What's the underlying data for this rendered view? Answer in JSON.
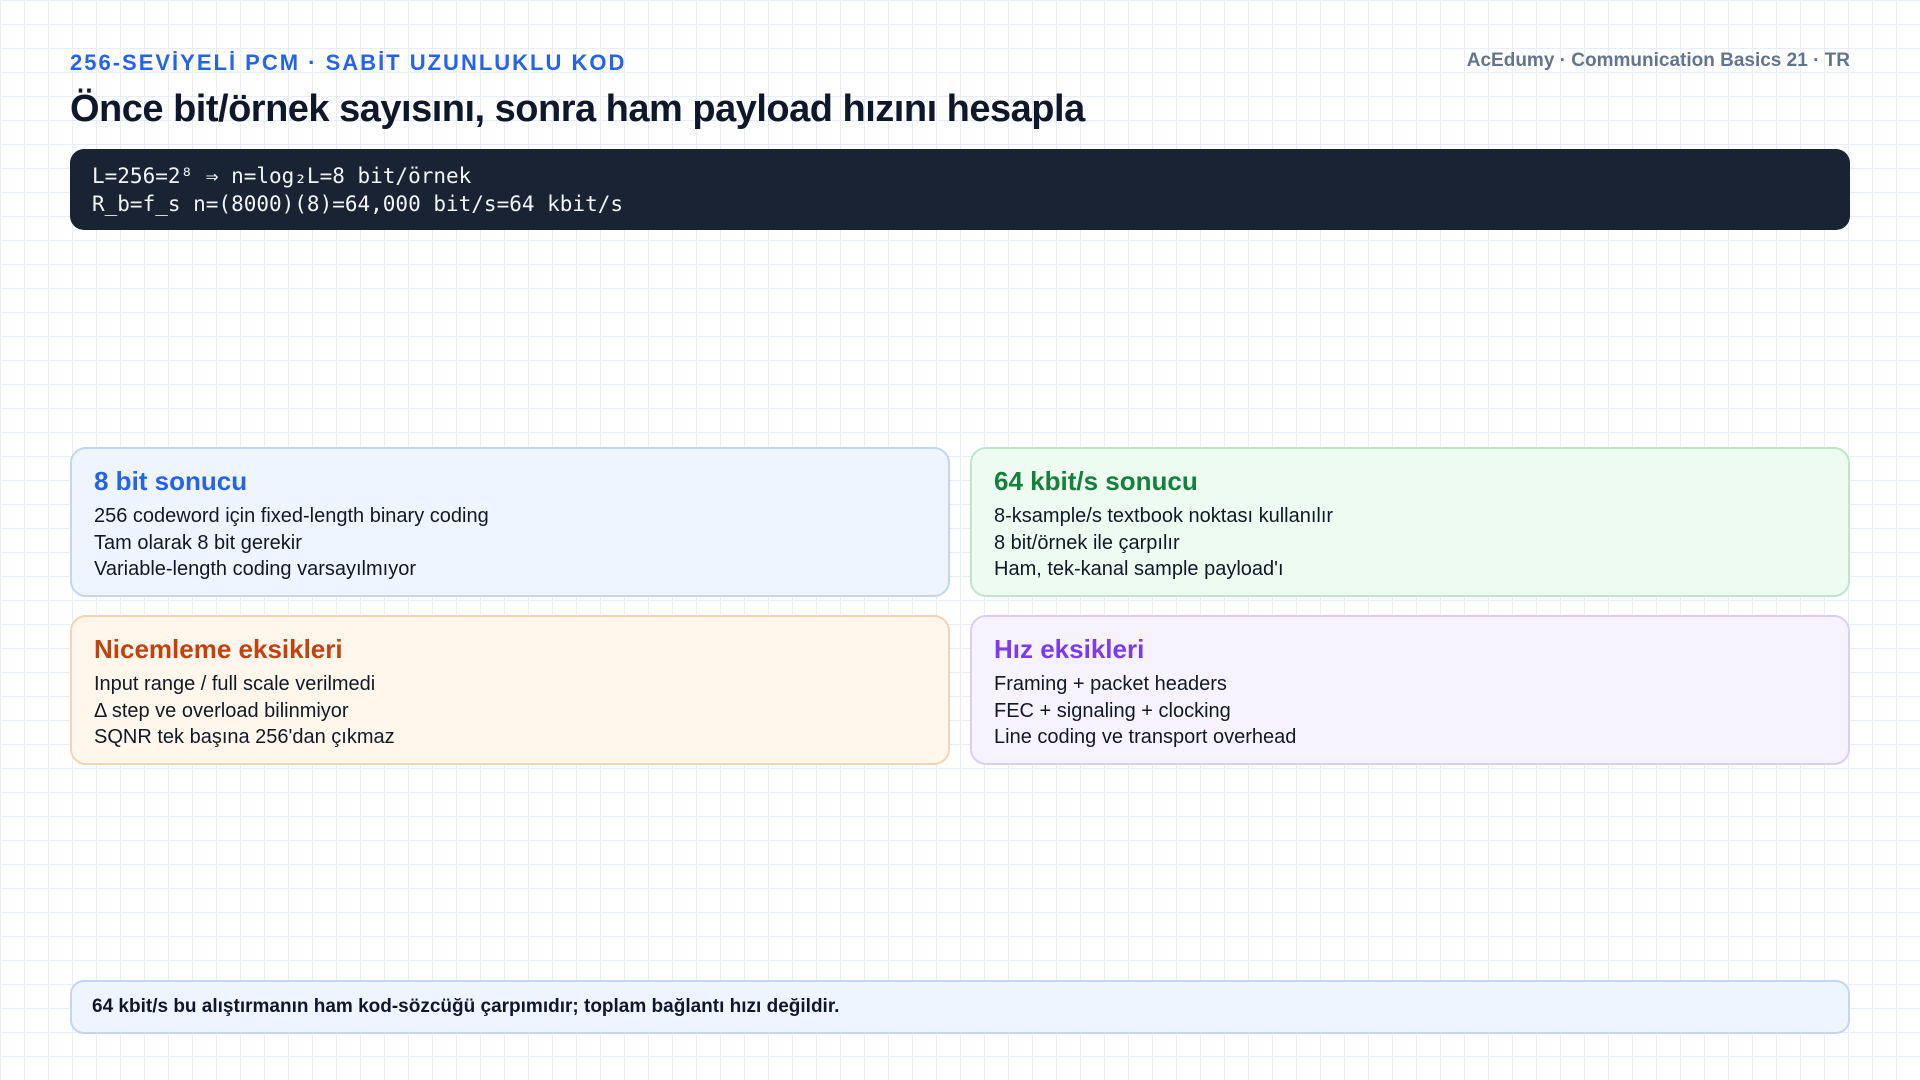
{
  "header": {
    "kicker": "256-SEVİYELİ PCM · SABİT UZUNLUKLU KOD",
    "brand": "AcEdumy · Communication Basics 21 · TR",
    "title": "Önce bit/örnek sayısını, sonra ham payload hızını hesapla"
  },
  "formula": {
    "line1": "L=256=2⁸ ⇒ n=log₂L=8 bit/örnek",
    "line2": "R_b=f_s n=(8000)(8)=64,000 bit/s=64 kbit/s"
  },
  "cards": [
    {
      "title": "8 bit sonucu",
      "items": [
        "256 codeword için fixed-length binary coding",
        "Tam olarak 8 bit gerekir",
        "Variable-length coding varsayılmıyor"
      ]
    },
    {
      "title": "64 kbit/s sonucu",
      "items": [
        "8-ksample/s textbook noktası kullanılır",
        "8 bit/örnek ile çarpılır",
        "Ham, tek-kanal sample payload'ı"
      ]
    },
    {
      "title": "Nicemleme eksikleri",
      "items": [
        "Input range / full scale verilmedi",
        "Δ step ve overload bilinmiyor",
        "SQNR tek başına 256'dan çıkmaz"
      ]
    },
    {
      "title": "Hız eksikleri",
      "items": [
        "Framing + packet headers",
        "FEC + signaling + clocking",
        "Line coding ve transport overhead"
      ]
    }
  ],
  "footer": {
    "note": "64 kbit/s bu alıştırmanın ham kod-sözcüğü çarpımıdır; toplam bağlantı hızı değildir."
  }
}
